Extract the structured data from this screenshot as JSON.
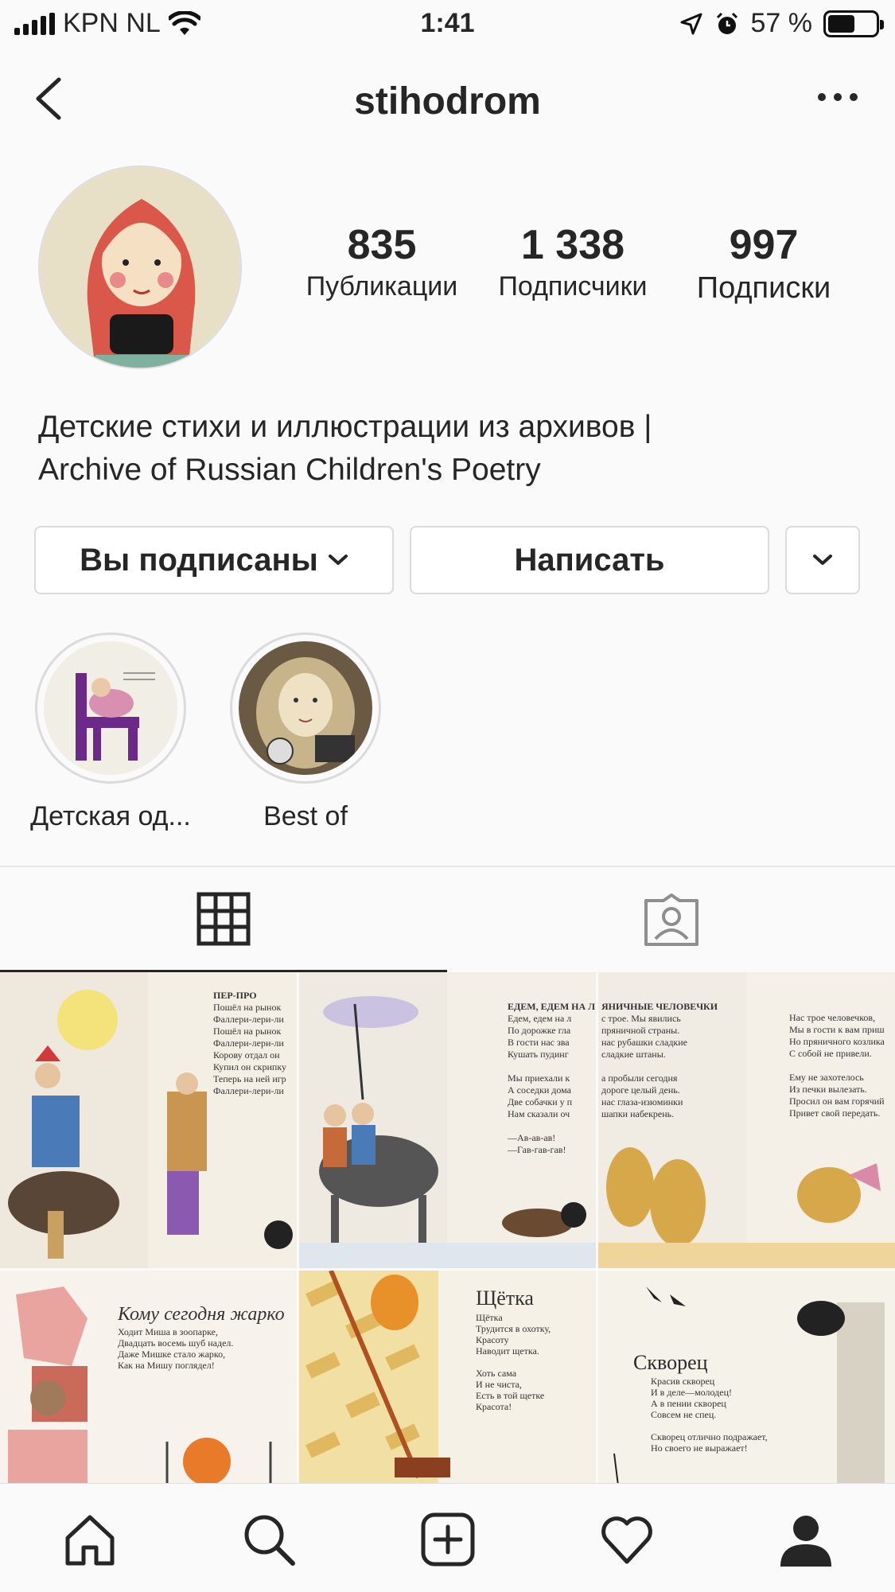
{
  "status_bar": {
    "carrier": "KPN NL",
    "time": "1:41",
    "battery_percent": "57 %",
    "battery_level": 0.57
  },
  "profile": {
    "username": "stihodrom",
    "stats": [
      {
        "value": "835",
        "label": "Публикации"
      },
      {
        "value": "1 338",
        "label": "Подписчики"
      },
      {
        "value": "997",
        "label": "Подписки"
      }
    ],
    "bio_line1": "Детские стихи и иллюстрации из архивов |",
    "bio_line2": "Archive of Russian Children's Poetry"
  },
  "actions": {
    "following_label": "Вы подписаны",
    "message_label": "Написать"
  },
  "highlights": [
    {
      "label": "Детская од..."
    },
    {
      "label": "Best of"
    }
  ],
  "tabs": [
    {
      "icon": "grid-icon"
    },
    {
      "icon": "tagged-icon"
    }
  ],
  "posts": [
    {
      "title": "ПЕР-ПРО",
      "text": [
        "Пошёл на рынок",
        "Фаллери-лери-ли",
        "Пошёл на рынок",
        "Фаллери-лери-ли",
        "Корову отдал он",
        "Купил он скрипку",
        "Теперь на ней игр",
        "Фаллери-лери-ли"
      ]
    },
    {
      "title": "ЕДЕМ, ЕДЕМ НА Л",
      "text": [
        "Едем, едем на л",
        "По дорожке гла",
        "В гости нас зва",
        "Кушать пудинг",
        "",
        "Мы приехали к",
        "А соседки дома",
        "Две собачки у п",
        "Нам сказали оч",
        "",
        "—Ав-ав-ав!",
        "—Гав-гав-гав!"
      ]
    },
    {
      "title": "ЯНИЧНЫЕ ЧЕЛОВЕЧКИ",
      "text": [
        "с трое. Мы явились",
        "пряничной страны.",
        "нас рубашки сладкие",
        "сладкие штаны.",
        "",
        "а пробыли сегодня",
        "дороге целый день.",
        "нас глаза-изюминки",
        "шапки набекрень."
      ],
      "text_right": [
        "Нас трое человечков,",
        "Мы в гости к вам приш",
        "Но пряничного козлика",
        "С собой не привели.",
        "",
        "Ему не захотелось",
        "Из печки вылезать.",
        "Просил он вам горячий",
        "Привет свой передать."
      ]
    },
    {
      "title": "Кому сегодня жарко",
      "text": [
        "Ходит Миша в зоопарке,",
        "Двадцать восемь шуб надел.",
        "Даже Мишке стало жарко,",
        "Как на Мишу поглядел!"
      ]
    },
    {
      "title": "Щётка",
      "text": [
        "Щётка",
        "Трудится в охотку,",
        "Красоту",
        "Наводит щетка.",
        "",
        "Хоть сама",
        "И не чиста,",
        "Есть в той щетке",
        "Красота!"
      ]
    },
    {
      "title": "Скворец",
      "text": [
        "Красив скворец",
        "И в деле—молодец!",
        "А в пении скворец",
        "Совсем не спец.",
        "",
        "Скворец отлично подражает,",
        "Но своего не выражает!"
      ]
    }
  ],
  "colors": {
    "text": "#262626",
    "border": "#dbdbdb",
    "background": "#fafafa"
  }
}
